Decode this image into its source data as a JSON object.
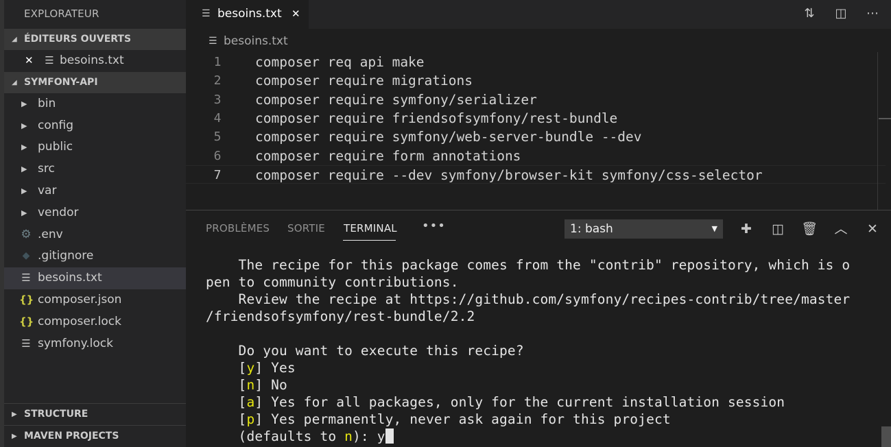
{
  "sidebar": {
    "title": "EXPLORATEUR",
    "open_editors": {
      "header": "ÉDITEURS OUVERTS",
      "files": [
        {
          "name": "besoins.txt"
        }
      ]
    },
    "project": {
      "header": "SYMFONY-API",
      "items": [
        {
          "name": "bin",
          "type": "folder"
        },
        {
          "name": "config",
          "type": "folder"
        },
        {
          "name": "public",
          "type": "folder"
        },
        {
          "name": "src",
          "type": "folder"
        },
        {
          "name": "var",
          "type": "folder"
        },
        {
          "name": "vendor",
          "type": "folder"
        },
        {
          "name": ".env",
          "type": "gear-icon"
        },
        {
          "name": ".gitignore",
          "type": "git-icon"
        },
        {
          "name": "besoins.txt",
          "type": "text-file-icon",
          "selected": true
        },
        {
          "name": "composer.json",
          "type": "json-icon"
        },
        {
          "name": "composer.lock",
          "type": "json-icon"
        },
        {
          "name": "symfony.lock",
          "type": "text-file-icon"
        }
      ]
    },
    "bottom_sections": [
      "STRUCTURE",
      "MAVEN PROJECTS"
    ]
  },
  "editor": {
    "tab_label": "besoins.txt",
    "breadcrumb": "besoins.txt",
    "current_line": 7,
    "lines": [
      {
        "num": "1",
        "text": "composer req api make"
      },
      {
        "num": "2",
        "text": "composer require migrations"
      },
      {
        "num": "3",
        "text": "composer require symfony/serializer"
      },
      {
        "num": "4",
        "text": "composer require friendsofsymfony/rest-bundle"
      },
      {
        "num": "5",
        "text": "composer require symfony/web-server-bundle --dev"
      },
      {
        "num": "6",
        "text": "composer require form annotations"
      },
      {
        "num": "7",
        "text": "composer require --dev symfony/browser-kit symfony/css-selector"
      }
    ]
  },
  "panel": {
    "tabs": [
      "PROBLÈMES",
      "SORTIE",
      "TERMINAL"
    ],
    "active_tab": "TERMINAL",
    "more": "•••",
    "terminal_select": "1: bash",
    "terminal": {
      "line1": "    The recipe for this package comes from the \"contrib\" repository, which is o",
      "line2": "pen to community contributions.",
      "line3": "    Review the recipe at https://github.com/symfony/recipes-contrib/tree/master",
      "line4": "/friendsofsymfony/rest-bundle/2.2",
      "line5": "",
      "line6": "    Do you want to execute this recipe?",
      "options": [
        {
          "key": "y",
          "text": "Yes"
        },
        {
          "key": "n",
          "text": "No"
        },
        {
          "key": "a",
          "text": "Yes for all packages, only for the current installation session"
        },
        {
          "key": "p",
          "text": "Yes permanently, never ask again for this project"
        }
      ],
      "prompt_prefix": "    (defaults to ",
      "prompt_default": "n",
      "prompt_suffix": "): ",
      "prompt_input": "y"
    }
  },
  "colors": {
    "highlight_yellow": "#e5e510",
    "sidebar_bg": "#252526",
    "editor_bg": "#1e1e1e"
  }
}
